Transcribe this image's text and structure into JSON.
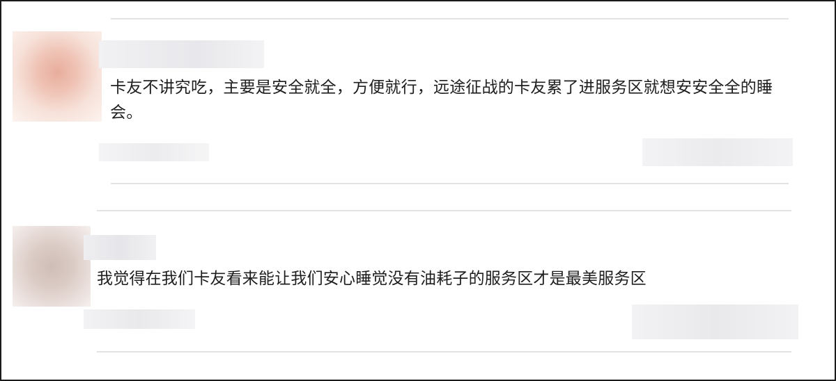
{
  "comments": [
    {
      "text": "卡友不讲究吃，主要是安全就全，方便就行，远途征战的卡友累了进服务区就想安安全全的睡会。"
    },
    {
      "text": "我觉得在我们卡友看来能让我们安心睡觉没有油耗子的服务区才是最美服务区"
    }
  ]
}
